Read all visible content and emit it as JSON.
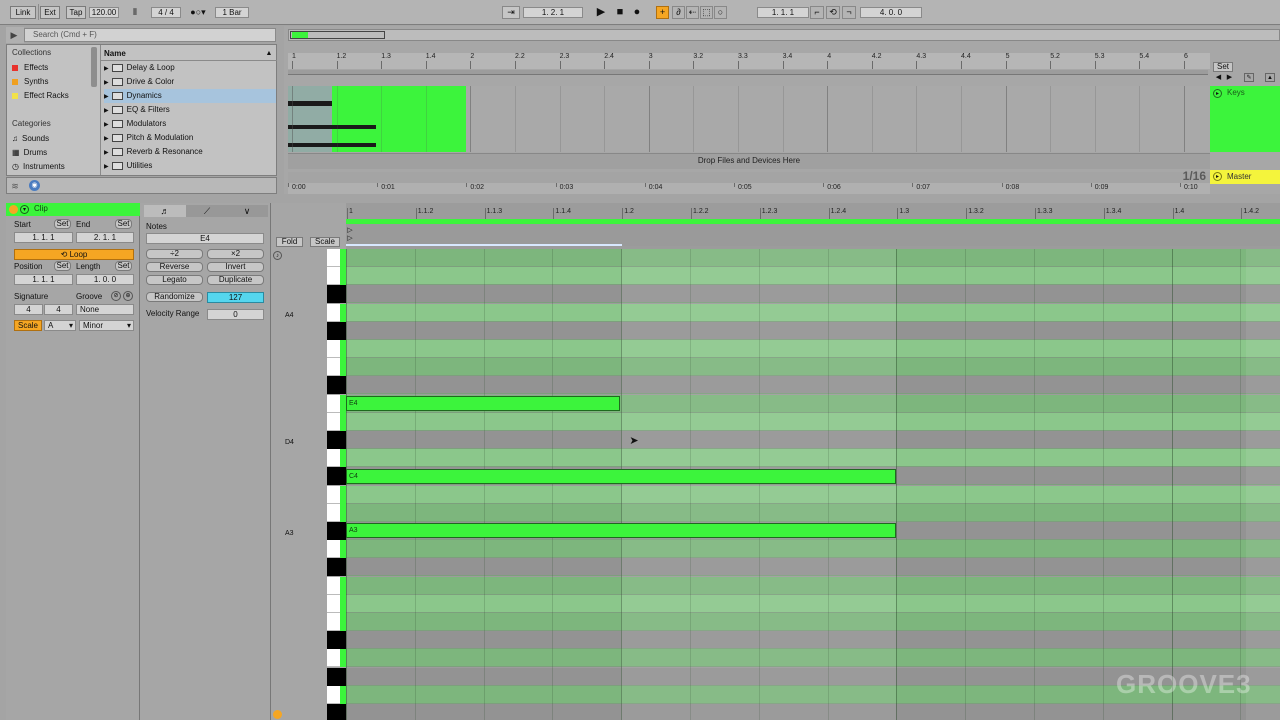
{
  "topbar": {
    "link": "Link",
    "ext": "Ext",
    "tap": "Tap",
    "tempo": "120.00",
    "time_sig": "4 / 4",
    "quantize": "1 Bar",
    "song_position": "1.   2.   1",
    "loop_start": "1.   1.   1",
    "loop_length": "4.   0.   0"
  },
  "browser": {
    "search_placeholder": "Search (Cmd + F)",
    "collections_label": "Collections",
    "collections": [
      {
        "label": "Effects",
        "color": "#e8322c"
      },
      {
        "label": "Synths",
        "color": "#f0a020"
      },
      {
        "label": "Effect Racks",
        "color": "#f2e24a"
      }
    ],
    "categories_label": "Categories",
    "categories": [
      {
        "label": "Sounds",
        "icon": "note-icon"
      },
      {
        "label": "Drums",
        "icon": "drum-grid-icon"
      },
      {
        "label": "Instruments",
        "icon": "clock-icon"
      }
    ],
    "name_header": "Name",
    "items": [
      {
        "label": "Delay & Loop"
      },
      {
        "label": "Drive & Color"
      },
      {
        "label": "Dynamics",
        "selected": true
      },
      {
        "label": "EQ & Filters"
      },
      {
        "label": "Modulators"
      },
      {
        "label": "Pitch & Modulation"
      },
      {
        "label": "Reverb & Resonance"
      },
      {
        "label": "Utilities"
      }
    ]
  },
  "arrangement": {
    "bar_labels": [
      "1",
      "1.2",
      "1.3",
      "1.4",
      "2",
      "2.2",
      "2.3",
      "2.4",
      "3",
      "3.2",
      "3.3",
      "3.4",
      "4",
      "4.2",
      "4.3",
      "4.4",
      "5",
      "5.2",
      "5.3",
      "5.4",
      "6"
    ],
    "time_labels": [
      "0:00",
      "0:01",
      "0:02",
      "0:03",
      "0:04",
      "0:05",
      "0:06",
      "0:07",
      "0:08",
      "0:09",
      "0:10"
    ],
    "drop_text": "Drop Files and Devices Here",
    "set_button": "Set",
    "track_name": "Keys",
    "master_name": "Master",
    "grid_value": "1/16",
    "accent": "#3cf43c"
  },
  "clip": {
    "title": "Clip",
    "start_label": "Start",
    "end_label": "End",
    "set_label": "Set",
    "start_value": "1.   1.   1",
    "end_value": "2.   1.   1",
    "loop_label": "Loop",
    "position_label": "Position",
    "length_label": "Length",
    "position_value": "1.   1.   1",
    "length_value": "1.   0.   0",
    "signature_label": "Signature",
    "groove_label": "Groove",
    "sig_num": "4",
    "sig_den": "4",
    "groove_value": "None",
    "scale_label": "Scale",
    "scale_root": "A",
    "scale_mode": "Minor"
  },
  "notes_panel": {
    "title": "Notes",
    "note_value": "E4",
    "div2": "÷2",
    "mul2": "×2",
    "reverse": "Reverse",
    "invert": "Invert",
    "legato": "Legato",
    "duplicate": "Duplicate",
    "randomize": "Randomize",
    "randomize_value": "127",
    "velocity_range_label": "Velocity Range",
    "velocity_range_value": "0"
  },
  "piano_roll": {
    "fold": "Fold",
    "scale": "Scale",
    "ruler": [
      "1",
      "1.1.2",
      "1.1.3",
      "1.1.4",
      "1.2",
      "1.2.2",
      "1.2.3",
      "1.2.4",
      "1.3",
      "1.3.2",
      "1.3.3",
      "1.3.4",
      "1.4",
      "1.4.2"
    ],
    "pitch_labels": [
      {
        "label": "A4"
      },
      {
        "label": "D4"
      },
      {
        "label": "A3"
      }
    ],
    "notes": [
      {
        "label": "E4"
      },
      {
        "label": "C4"
      },
      {
        "label": "A3"
      }
    ]
  },
  "watermark": "GROOVE3"
}
